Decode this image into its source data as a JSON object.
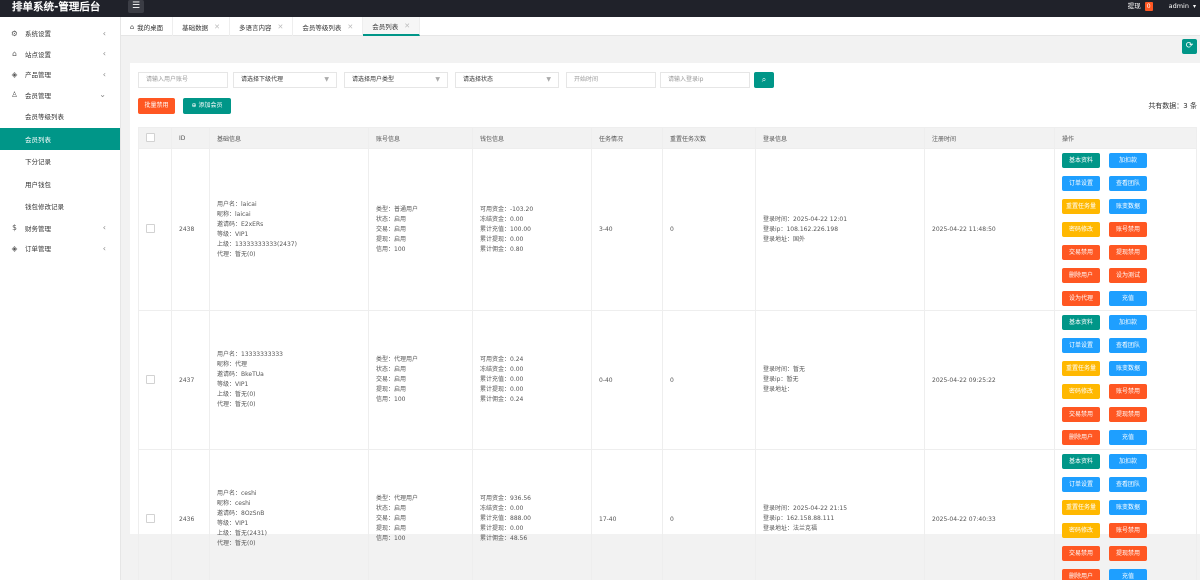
{
  "topbar": {
    "title": "排单系统-管理后台",
    "notice_label": "提现",
    "notice_count": "0",
    "user": "admin"
  },
  "sidebar": {
    "items": [
      {
        "label": "系统设置",
        "icon": "gear-icon",
        "glyph": "⚙"
      },
      {
        "label": "站点设置",
        "icon": "home-icon",
        "glyph": "⌂"
      },
      {
        "label": "产品管理",
        "icon": "cube-icon",
        "glyph": "◈"
      },
      {
        "label": "会员管理",
        "icon": "user-icon",
        "glyph": "♙"
      }
    ],
    "subitems": [
      "会员等级列表",
      "会员列表",
      "下分记录",
      "用户钱包",
      "钱包修改记录"
    ],
    "items2": [
      {
        "label": "财务管理",
        "icon": "dollar-icon",
        "glyph": "$"
      },
      {
        "label": "订单管理",
        "icon": "cube-icon",
        "glyph": "◈"
      }
    ]
  },
  "tabs": [
    "我的桌面",
    "基础数据",
    "多语言内容",
    "会员等级列表",
    "会员列表"
  ],
  "filters": {
    "account_placeholder": "请输入用户账号",
    "agent": "请选择下级代理",
    "type": "请选择用户类型",
    "status": "请选择状态",
    "time_placeholder": "开始时间",
    "ip_placeholder": "请输入登录ip"
  },
  "actions": {
    "batch": "批量禁用",
    "add": "添加会员",
    "total": "共有数据：3 条"
  },
  "table": {
    "headers": [
      "ID",
      "基础信息",
      "账号信息",
      "钱包信息",
      "任务情况",
      "重置任务次数",
      "登录信息",
      "注册时间",
      "操作"
    ],
    "rows": [
      {
        "id": "2438",
        "basic": [
          "用户名：laicai",
          "昵称：laicai",
          "邀请码：E2xERs",
          "等级：VIP1",
          "上级：13333333333(2437)",
          "代理：暂无(0)"
        ],
        "account": [
          "类型：普通用户",
          "状态：启用",
          "交易：启用",
          "提现：启用",
          "信用：100"
        ],
        "wallet": [
          "可用资金：-103.20",
          "冻结资金：0.00",
          "累计充值：100.00",
          "累计提现：0.00",
          "累计佣金：0.80"
        ],
        "task": "3-40",
        "reset": "0",
        "login": [
          "登录时间：2025-04-22 12:01",
          "登录ip：108.162.226.198",
          "登录地址：国外"
        ],
        "reg": "2025-04-22 11:48:50",
        "ops": [
          {
            "label": "基本资料",
            "color": "green"
          },
          {
            "label": "加扣款",
            "color": "blue"
          },
          {
            "label": "订单设置",
            "color": "blue"
          },
          {
            "label": "查看团队",
            "color": "blue"
          },
          {
            "label": "重置任务量",
            "color": "yellow"
          },
          {
            "label": "账变数据",
            "color": "blue"
          },
          {
            "label": "密码修改",
            "color": "yellow"
          },
          {
            "label": "账号禁用",
            "color": "red"
          },
          {
            "label": "交易禁用",
            "color": "red"
          },
          {
            "label": "提现禁用",
            "color": "red"
          },
          {
            "label": "删除用户",
            "color": "red"
          },
          {
            "label": "设为测试",
            "color": "red"
          },
          {
            "label": "设为代理",
            "color": "red"
          },
          {
            "label": "充值",
            "color": "blue"
          }
        ]
      },
      {
        "id": "2437",
        "basic": [
          "用户名：13333333333",
          "昵称：代理",
          "邀请码：BkeTUa",
          "等级：VIP1",
          "上级：暂无(0)",
          "代理：暂无(0)"
        ],
        "account": [
          "类型：代理用户",
          "状态：启用",
          "交易：启用",
          "提现：启用",
          "信用：100"
        ],
        "wallet": [
          "可用资金：0.24",
          "冻结资金：0.00",
          "累计充值：0.00",
          "累计提现：0.00",
          "累计佣金：0.24"
        ],
        "task": "0-40",
        "reset": "0",
        "login": [
          "登录时间：暂无",
          "登录ip：暂无",
          "登录地址："
        ],
        "reg": "2025-04-22 09:25:22",
        "ops": [
          {
            "label": "基本资料",
            "color": "green"
          },
          {
            "label": "加扣款",
            "color": "blue"
          },
          {
            "label": "订单设置",
            "color": "blue"
          },
          {
            "label": "查看团队",
            "color": "blue"
          },
          {
            "label": "重置任务量",
            "color": "yellow"
          },
          {
            "label": "账变数据",
            "color": "blue"
          },
          {
            "label": "密码修改",
            "color": "yellow"
          },
          {
            "label": "账号禁用",
            "color": "red"
          },
          {
            "label": "交易禁用",
            "color": "red"
          },
          {
            "label": "提现禁用",
            "color": "red"
          },
          {
            "label": "删除用户",
            "color": "red"
          },
          {
            "label": "充值",
            "color": "blue"
          }
        ]
      },
      {
        "id": "2436",
        "basic": [
          "用户名：ceshi",
          "昵称：ceshi",
          "邀请码：8OzSnB",
          "等级：VIP1",
          "上级：暂无(2431)",
          "代理：暂无(0)"
        ],
        "account": [
          "类型：代理用户",
          "状态：启用",
          "交易：启用",
          "提现：启用",
          "信用：100"
        ],
        "wallet": [
          "可用资金：936.56",
          "冻结资金：0.00",
          "累计充值：888.00",
          "累计提现：0.00",
          "累计佣金：48.56"
        ],
        "task": "17-40",
        "reset": "0",
        "login": [
          "登录时间：2025-04-22 21:15",
          "登录ip：162.158.88.111",
          "登录地址：法兰克福"
        ],
        "reg": "2025-04-22 07:40:33",
        "ops": [
          {
            "label": "基本资料",
            "color": "green"
          },
          {
            "label": "加扣款",
            "color": "blue"
          },
          {
            "label": "订单设置",
            "color": "blue"
          },
          {
            "label": "查看团队",
            "color": "blue"
          },
          {
            "label": "重置任务量",
            "color": "yellow"
          },
          {
            "label": "账变数据",
            "color": "blue"
          },
          {
            "label": "密码修改",
            "color": "yellow"
          },
          {
            "label": "账号禁用",
            "color": "red"
          },
          {
            "label": "交易禁用",
            "color": "red"
          },
          {
            "label": "提现禁用",
            "color": "red"
          },
          {
            "label": "删除用户",
            "color": "red"
          },
          {
            "label": "充值",
            "color": "blue"
          }
        ]
      }
    ]
  },
  "colors": {
    "accent": "#009688",
    "blue": "#1e9fff",
    "yellow": "#ffb800",
    "red": "#ff5722"
  }
}
